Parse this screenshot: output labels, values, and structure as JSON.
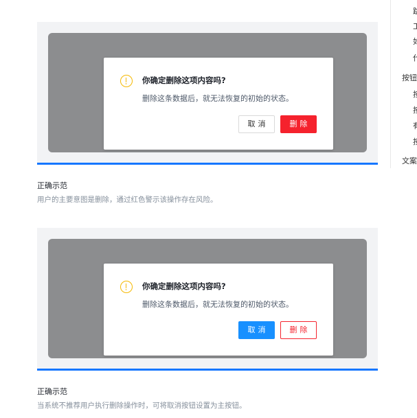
{
  "examples": [
    {
      "dialog": {
        "title": "你确定删除这项内容吗?",
        "description": "删除这条数据后，就无法恢复的初始的状态。",
        "cancel_label": "取消",
        "delete_label": "删除"
      },
      "caption_title": "正确示范",
      "caption_desc": "用户的主要意图是删除，通过红色警示该操作存在风险。"
    },
    {
      "dialog": {
        "title": "你确定删除这项内容吗?",
        "description": "删除这条数据后，就无法恢复的初始的状态。",
        "cancel_label": "取消",
        "delete_label": "删除"
      },
      "caption_title": "正确示范",
      "caption_desc": "当系统不推荐用户执行删除操作时，可将取消按钮设置为主按钮。"
    }
  ],
  "toc": {
    "items": [
      "跳",
      "工",
      "如",
      "代",
      "按钮",
      "按",
      "按",
      "有",
      "按",
      "文案"
    ]
  },
  "colors": {
    "danger": "#f5222d",
    "primary": "#1890ff",
    "accent_bar": "#1677ff",
    "warning": "#f5b800",
    "mask": "#8c8d8f"
  }
}
